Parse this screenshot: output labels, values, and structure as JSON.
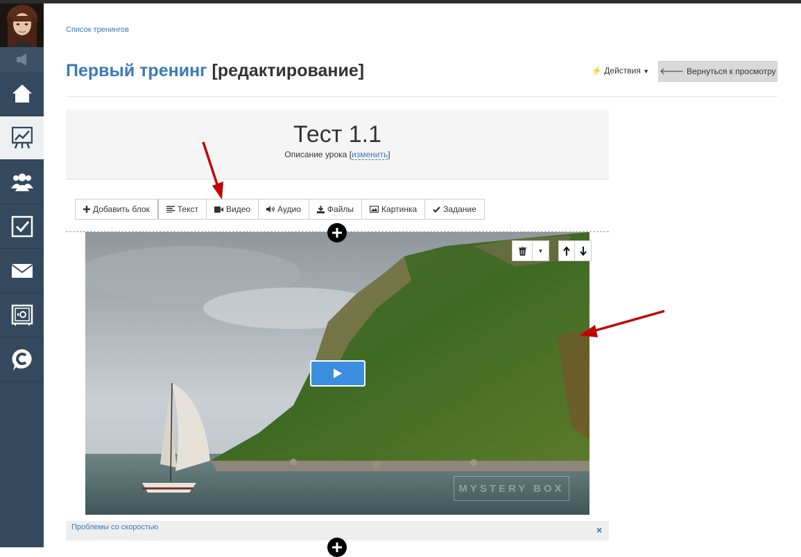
{
  "breadcrumb": {
    "label": "Список тренингов"
  },
  "header": {
    "title": "Первый тренинг",
    "title_suffix": "[редактирование]",
    "actions_label": "Действия",
    "back_label": "Вернуться к просмотру"
  },
  "lesson": {
    "title": "Тест 1.1",
    "description": "Описание урока",
    "edit_label": "изменить"
  },
  "toolbar": {
    "items": [
      {
        "label": "Добавить блок",
        "icon": "plus-icon"
      },
      {
        "label": "Текст",
        "icon": "text-lines-icon"
      },
      {
        "label": "Видео",
        "icon": "video-camera-icon"
      },
      {
        "label": "Аудио",
        "icon": "speaker-icon"
      },
      {
        "label": "Файлы",
        "icon": "download-icon"
      },
      {
        "label": "Картинка",
        "icon": "image-icon"
      },
      {
        "label": "Задание",
        "icon": "check-icon"
      }
    ]
  },
  "video": {
    "watermark": "MYSTERY BOX"
  },
  "alert": {
    "text": "Проблемы со скоростью",
    "close": "×"
  },
  "sidebar": {
    "items": [
      {
        "icon": "home-icon"
      },
      {
        "icon": "chart-board-icon",
        "active": true
      },
      {
        "icon": "users-icon"
      },
      {
        "icon": "checkbox-icon"
      },
      {
        "icon": "mail-icon"
      },
      {
        "icon": "safe-icon"
      },
      {
        "icon": "chat-c-icon"
      }
    ]
  },
  "colors": {
    "accent": "#3a7ab7",
    "sidebar": "#34495e",
    "play_button": "#3c8ee0",
    "arrow": "#c00000"
  }
}
